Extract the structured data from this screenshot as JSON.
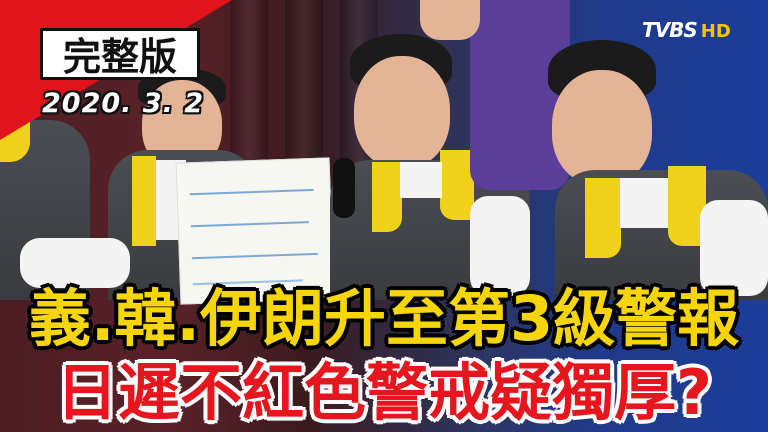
{
  "badge": {
    "title": "完整版",
    "date": "2020. 3. 2",
    "color": "#e1141c"
  },
  "logo": {
    "main": "TVBS",
    "hd": "HD"
  },
  "headline": {
    "line1": "義.韓.伊朗升至第3級警報",
    "line2": "日遲不紅色警戒疑獨厚?",
    "line1_color": "#f6d60a",
    "line2_color": "#e5161d"
  }
}
